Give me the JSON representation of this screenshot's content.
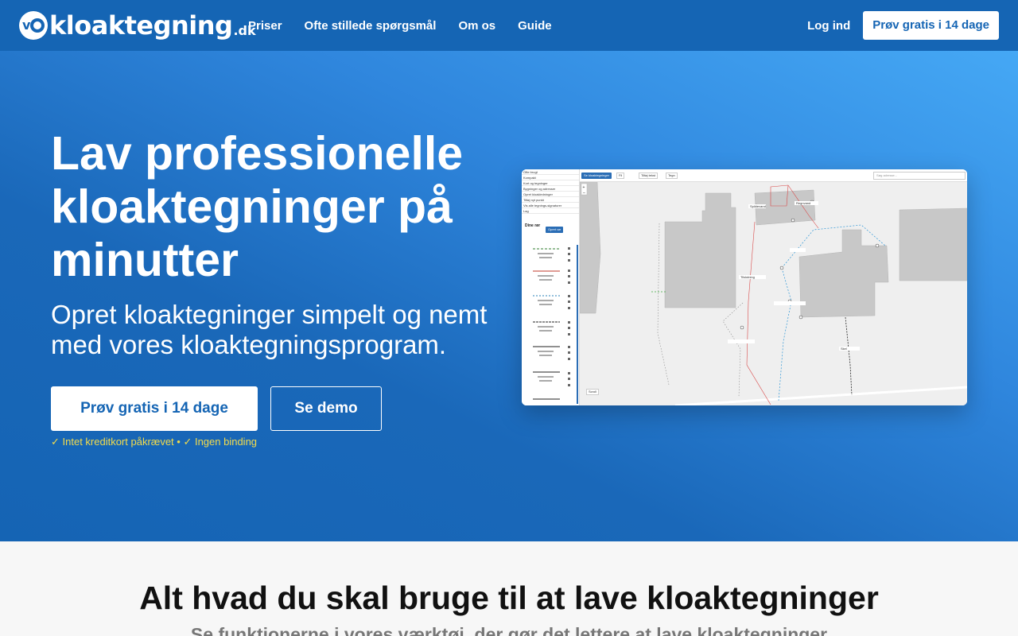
{
  "brand": {
    "name": "kloaktegning",
    "tld": ".dk"
  },
  "nav": {
    "links": [
      "Priser",
      "Ofte stillede spørgsmål",
      "Om os",
      "Guide"
    ],
    "login": "Log ind",
    "cta": "Prøv gratis i 14 dage"
  },
  "hero": {
    "title": "Lav professionelle kloaktegninger på minutter",
    "subtitle": "Opret kloaktegninger simpelt og nemt med vores kloaktegningsprogram.",
    "primary_cta": "Prøv gratis i 14 dage",
    "secondary_cta": "Se demo",
    "fineprint": "✓ Intet kreditkort påkrævet • ✓ Ingen binding"
  },
  "preview": {
    "side_items": [
      "Ofte brugt",
      "Kompakt",
      "Kort og tegninger",
      "Bygninger og adresser",
      "Opret kloakledninger",
      "Tilføj nyt punkt",
      "Vis alle tegnings-signaturer",
      "Lag"
    ],
    "section_title": "Dine rør",
    "add_button": "Opret rør",
    "top_button": "Se kloaktegninger",
    "chips": [
      "Fil",
      "Tilføj tekst",
      "Tegn"
    ],
    "search_placeholder": "Søg adresse...",
    "map_labels": [
      "Spildevand",
      "Regnvand",
      "Tilslutning",
      "Skel"
    ],
    "bottom_button": "Scroll"
  },
  "section2": {
    "title": "Alt hvad du skal bruge til at lave kloaktegninger",
    "subtitle": "Se funktionerne i vores værktøj, der gør det lettere at lave kloaktegninger"
  },
  "colors": {
    "brand_blue": "#1565b4",
    "hero_light": "#45a8f5",
    "accent_yellow": "#f3dc4c"
  }
}
